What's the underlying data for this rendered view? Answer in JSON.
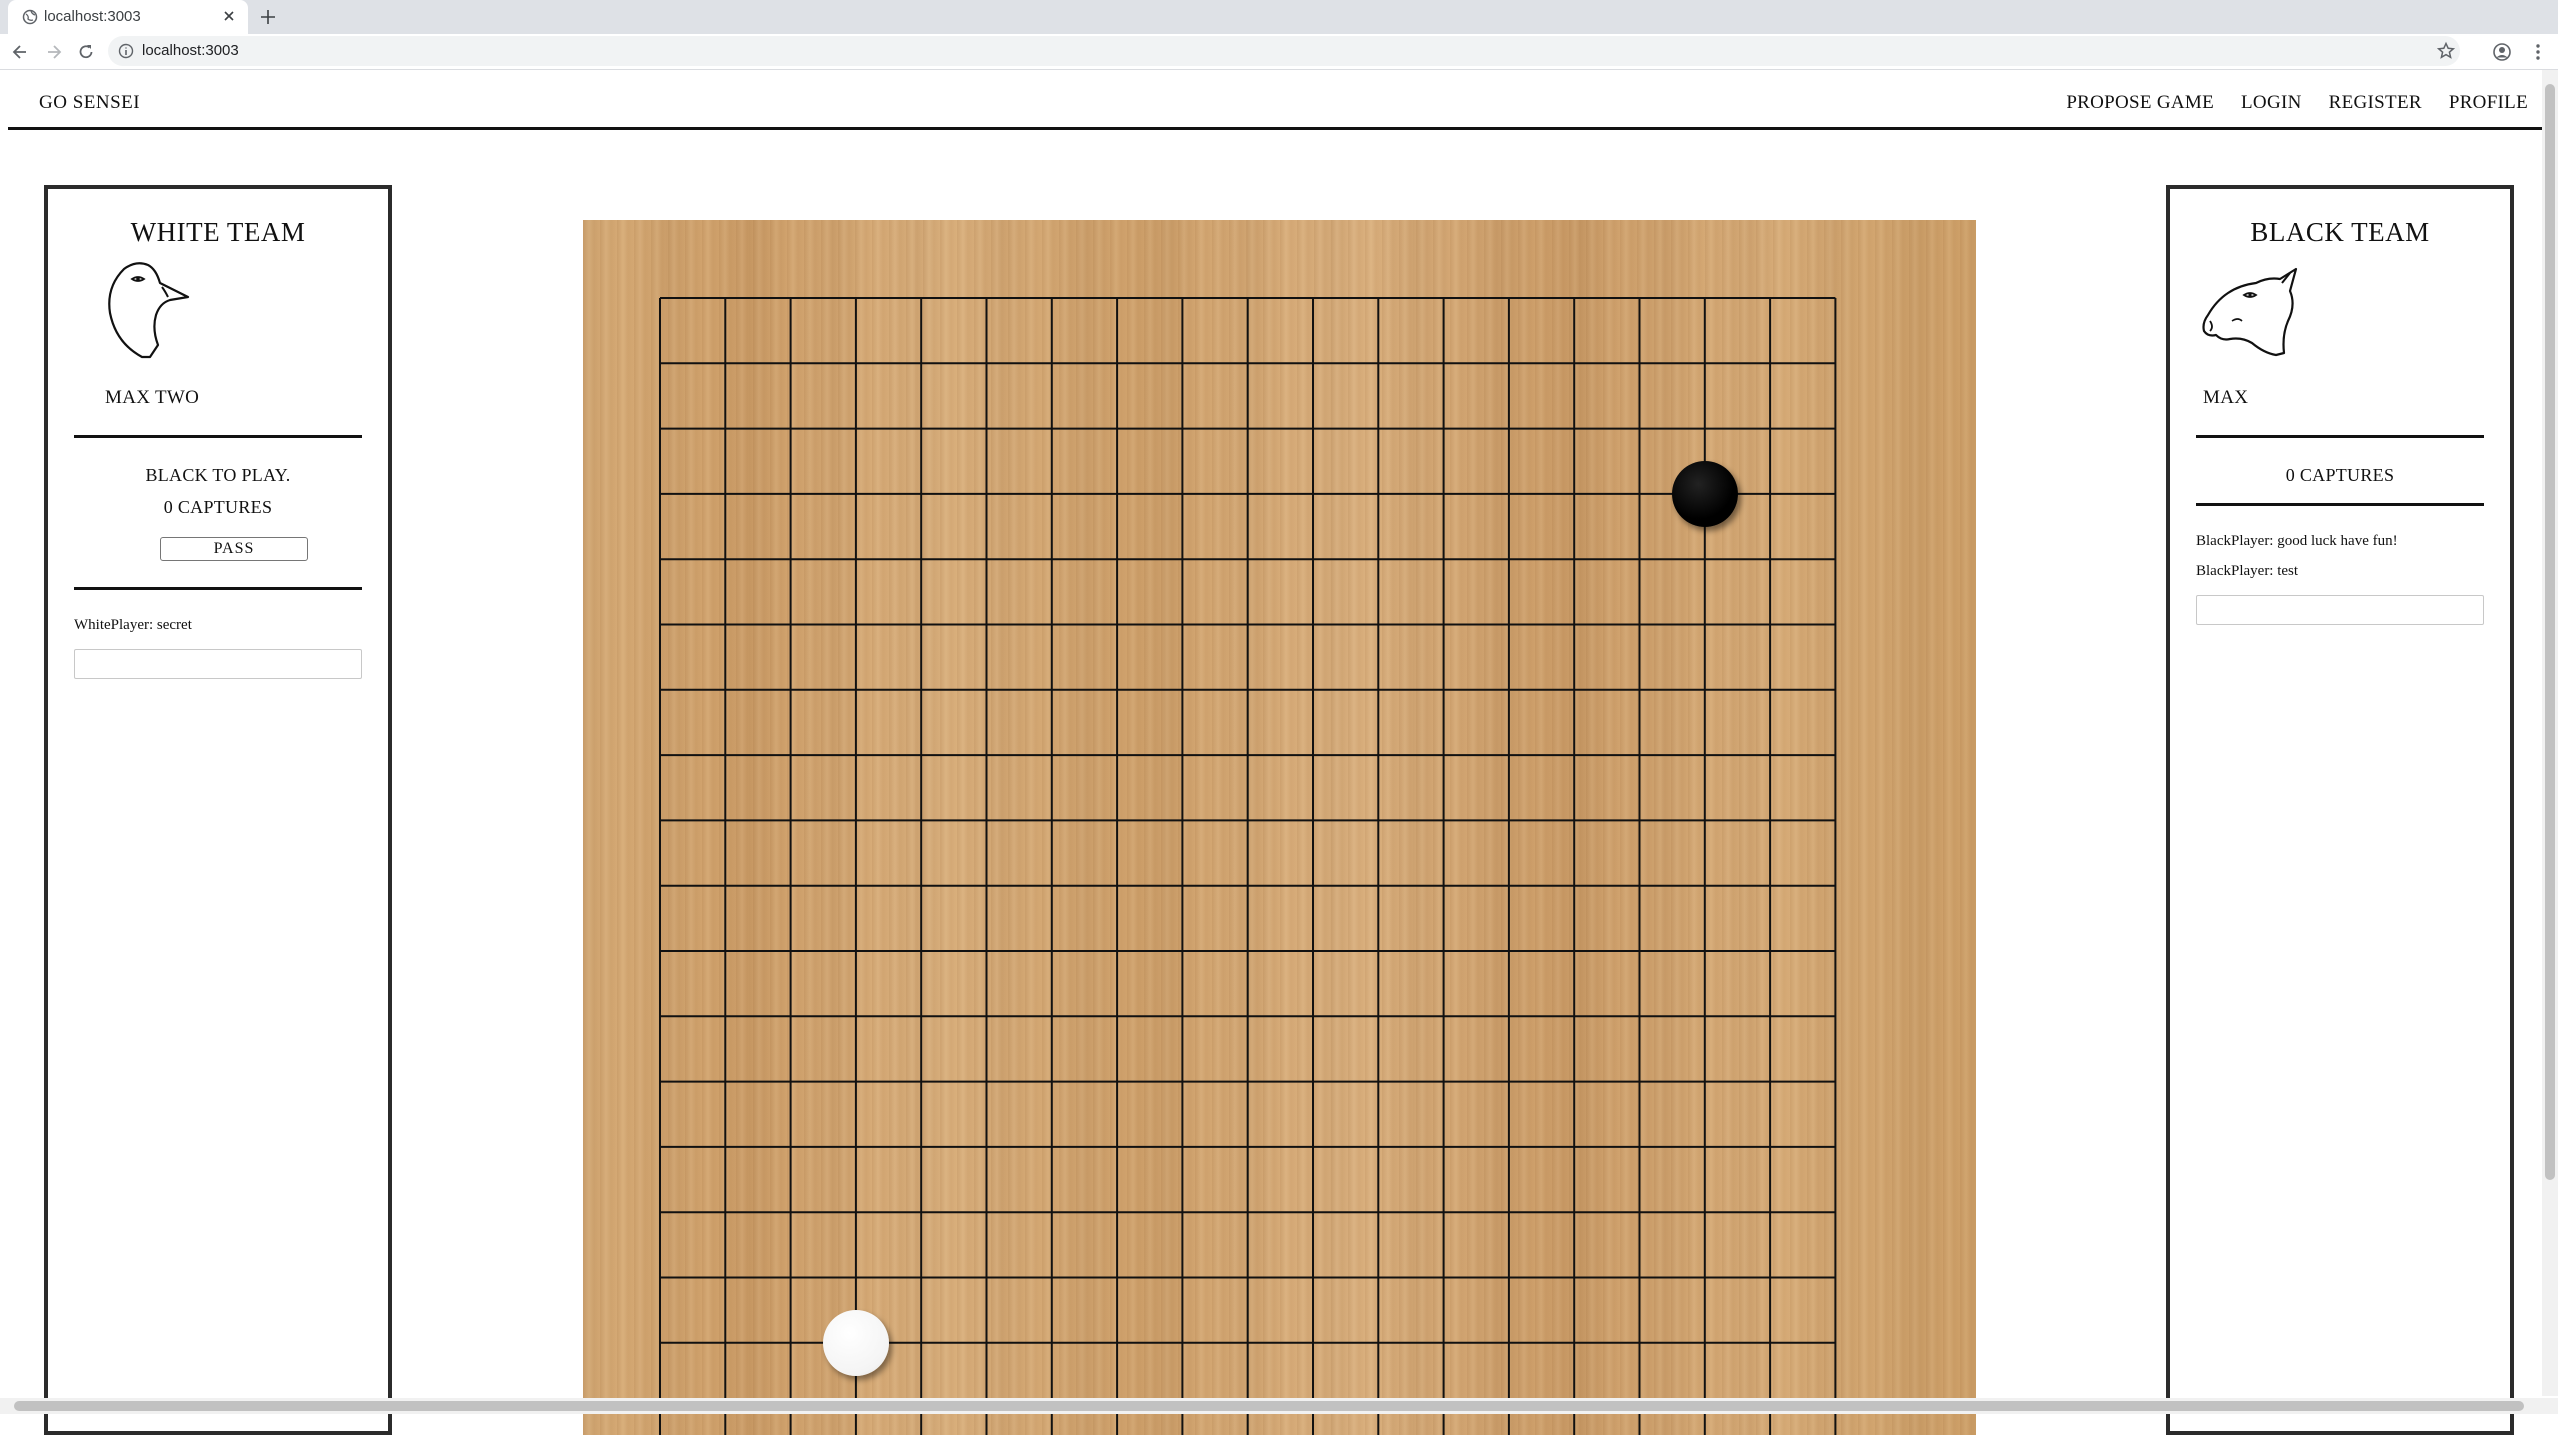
{
  "browser": {
    "tab_title": "localhost:3003",
    "url": "localhost:3003"
  },
  "nav": {
    "brand": "GO SENSEI",
    "links": [
      "PROPOSE GAME",
      "LOGIN",
      "REGISTER",
      "PROFILE"
    ]
  },
  "white_panel": {
    "title": "WHITE TEAM",
    "avatar_icon": "goose-head-icon",
    "player_name": "MAX TWO",
    "turn_status": "BLACK TO PLAY.",
    "captures": "0 CAPTURES",
    "pass_label": "PASS",
    "chat_messages": [
      "WhitePlayer: secret"
    ],
    "chat_input_value": ""
  },
  "black_panel": {
    "title": "BLACK TEAM",
    "avatar_icon": "boar-head-icon",
    "player_name": "MAX",
    "captures": "0 CAPTURES",
    "chat_messages": [
      "BlackPlayer: good luck have fun!",
      "BlackPlayer: test"
    ],
    "chat_input_value": ""
  },
  "board": {
    "size": 19,
    "stones": [
      {
        "color": "black",
        "col": 16,
        "row": 3
      },
      {
        "color": "white",
        "col": 3,
        "row": 16
      }
    ]
  }
}
